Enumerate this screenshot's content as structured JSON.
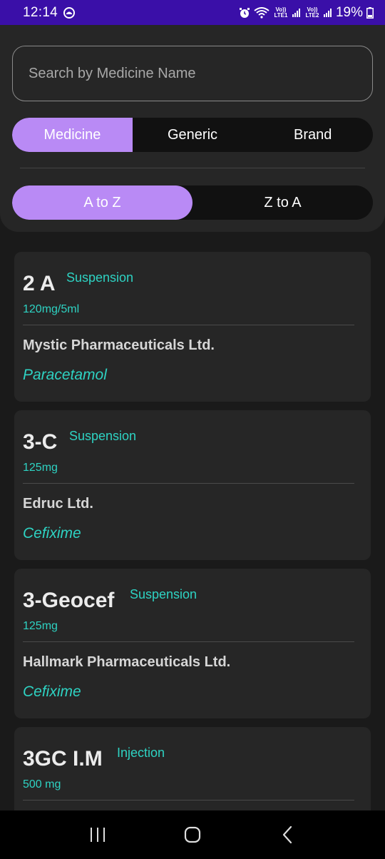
{
  "status": {
    "time": "12:14",
    "net1": "Vo)) LTE1",
    "net2": "Vo)) LTE2",
    "battery": "19%"
  },
  "search": {
    "placeholder": "Search by Medicine Name",
    "value": ""
  },
  "type_tabs": [
    {
      "label": "Medicine",
      "active": true
    },
    {
      "label": "Generic",
      "active": false
    },
    {
      "label": "Brand",
      "active": false
    }
  ],
  "sort_tabs": [
    {
      "label": "A to Z",
      "active": true
    },
    {
      "label": "Z to A",
      "active": false
    }
  ],
  "medicines": [
    {
      "name": "2 A",
      "form": "Suspension",
      "strength": "120mg/5ml",
      "company": "Mystic Pharmaceuticals Ltd.",
      "generic": "Paracetamol"
    },
    {
      "name": "3-C",
      "form": "Suspension",
      "strength": "125mg",
      "company": "Edruc Ltd.",
      "generic": "Cefixime"
    },
    {
      "name": "3-Geocef",
      "form": "Suspension",
      "strength": "125mg",
      "company": "Hallmark Pharmaceuticals Ltd.",
      "generic": "Cefixime"
    },
    {
      "name": "3GC I.M",
      "form": "Injection",
      "strength": "500 mg",
      "company": "",
      "generic": ""
    }
  ],
  "colors": {
    "accent": "#b98af5",
    "teal": "#2ed3c3",
    "status_bar": "#3a0fa8"
  }
}
